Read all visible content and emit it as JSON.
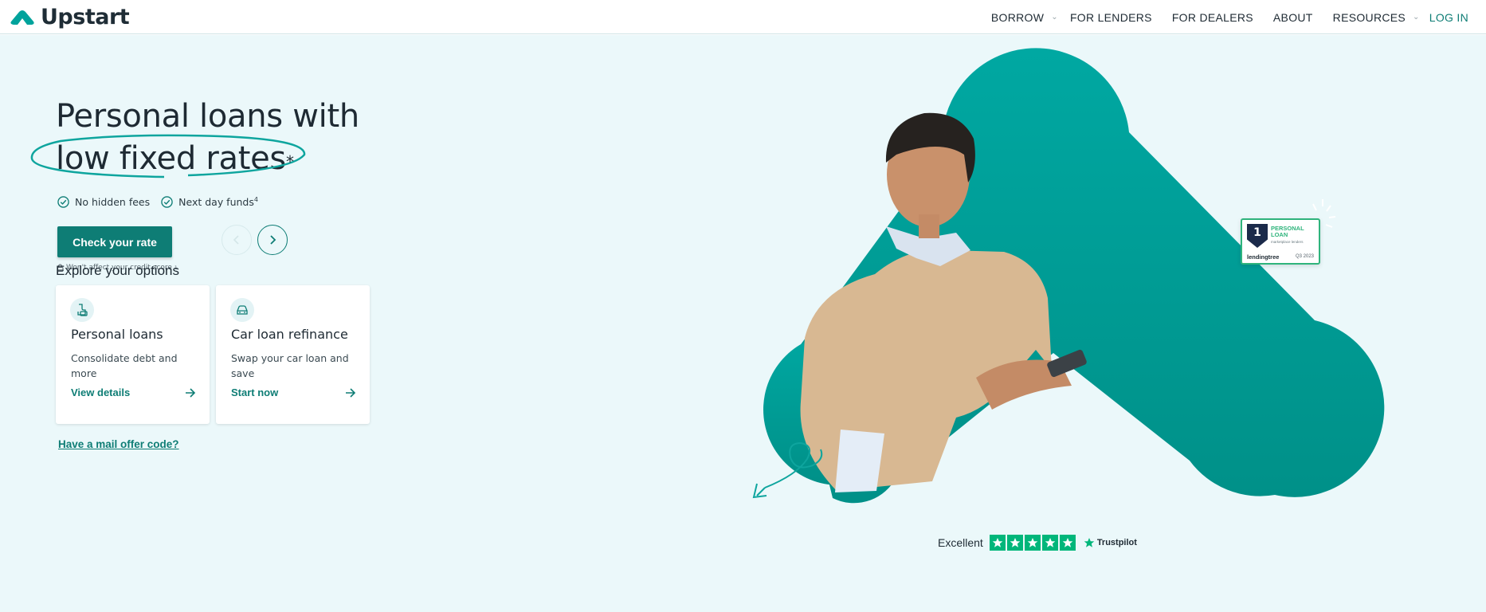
{
  "header": {
    "logo_text": "Upstart",
    "nav": [
      {
        "label": "BORROW",
        "has_dropdown": true
      },
      {
        "label": "FOR LENDERS",
        "has_dropdown": false
      },
      {
        "label": "FOR DEALERS",
        "has_dropdown": false
      },
      {
        "label": "ABOUT",
        "has_dropdown": false
      },
      {
        "label": "RESOURCES",
        "has_dropdown": true
      },
      {
        "label": "LOG IN",
        "has_dropdown": false
      }
    ]
  },
  "hero": {
    "headline_line1": "Personal loans with",
    "headline_line2": "low fixed rates",
    "headline_sup": "*",
    "features": [
      {
        "text": "No hidden fees",
        "sup": ""
      },
      {
        "text": "Next day funds",
        "sup": "4"
      }
    ],
    "cta_label": "Check your rate",
    "disclaimer": "Won't affect your credit score",
    "disclaimer_sup": "1"
  },
  "explore": {
    "title": "Explore your options",
    "cards": [
      {
        "icon": "personal-loan-icon",
        "title": "Personal loans",
        "description": "Consolidate debt and more",
        "link": "View details"
      },
      {
        "icon": "car-icon",
        "title": "Car loan refinance",
        "description": "Swap your car loan and save",
        "link": "Start now"
      }
    ]
  },
  "mail_offer": "Have a mail offer code?",
  "award_badge": {
    "rank": "1",
    "title": "PERSONAL LOAN",
    "subtitle": "marketplace lenders",
    "brand": "lendingtree",
    "quarter": "Q3 2023"
  },
  "trustpilot": {
    "label": "Excellent",
    "rating_stars": 5,
    "brand": "Trustpilot"
  },
  "colors": {
    "brand_teal": "#0e7d75",
    "hero_bg": "#ebf8fa",
    "shape_teal": "#00a39c",
    "trustpilot_green": "#00b67a"
  }
}
